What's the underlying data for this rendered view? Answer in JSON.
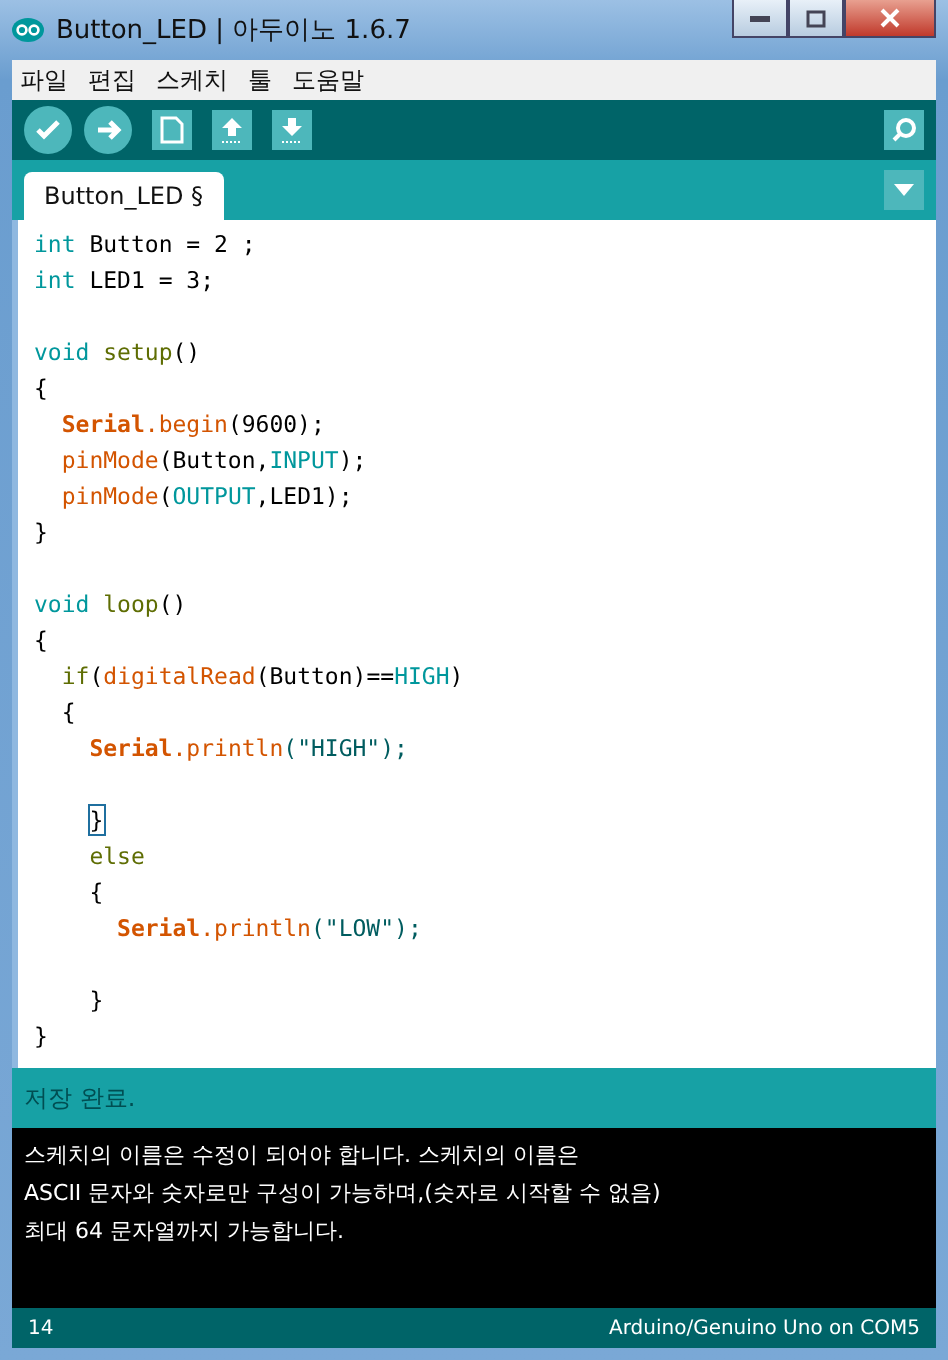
{
  "window": {
    "title": "Button_LED | 아두이노 1.6.7"
  },
  "menu": [
    "파일",
    "편집",
    "스케치",
    "툴",
    "도움말"
  ],
  "toolbar": [
    {
      "kind": "verify"
    },
    {
      "kind": "upload"
    },
    {
      "kind": "new"
    },
    {
      "kind": "open"
    },
    {
      "kind": "save"
    }
  ],
  "tabs": [
    {
      "label": "Button_LED §",
      "selected": true
    }
  ],
  "code": [
    [
      [
        {
          "kind": "type",
          "text": "int"
        },
        {
          "kind": "plain",
          "text": " Button = 2 ;"
        }
      ],
      [
        {
          "kind": "type",
          "text": "int"
        },
        {
          "kind": "plain",
          "text": " LED1 = 3;"
        }
      ]
    ],
    [
      [
        {
          "kind": "type",
          "text": "void "
        },
        {
          "kind": "fn",
          "text": "setup"
        },
        {
          "kind": "plain",
          "text": "()"
        }
      ],
      [
        {
          "kind": "plain",
          "text": "{"
        }
      ],
      [
        {
          "kind": "serial",
          "text": "  Serial"
        },
        {
          "kind": "call",
          "text": ".begin"
        },
        {
          "kind": "plain",
          "text": "(9600);"
        }
      ],
      [
        {
          "kind": "call",
          "text": "  pinMode"
        },
        {
          "kind": "plain",
          "text": "(Button,"
        },
        {
          "kind": "const",
          "text": "INPUT"
        },
        {
          "kind": "plain",
          "text": ");"
        }
      ],
      [
        {
          "kind": "call",
          "text": "  pinMode"
        },
        {
          "kind": "plain",
          "text": "("
        },
        {
          "kind": "const",
          "text": "OUTPUT"
        },
        {
          "kind": "plain",
          "text": ",LED1);"
        }
      ],
      [
        {
          "kind": "plain",
          "text": "}"
        }
      ]
    ],
    [
      [
        {
          "kind": "type",
          "text": "void "
        },
        {
          "kind": "fn",
          "text": "loop"
        },
        {
          "kind": "plain",
          "text": "()"
        }
      ],
      [
        {
          "kind": "plain",
          "text": "{"
        }
      ],
      [
        {
          "kind": "fn",
          "text": "  if"
        },
        {
          "kind": "plain",
          "text": "("
        },
        {
          "kind": "call",
          "text": "digitalRead"
        },
        {
          "kind": "plain",
          "text": "(Button)=="
        },
        {
          "kind": "const",
          "text": "HIGH"
        },
        {
          "kind": "plain",
          "text": ")"
        }
      ],
      [
        {
          "kind": "plain",
          "text": "  {"
        }
      ],
      [
        {
          "kind": "serial",
          "text": "    Serial"
        },
        {
          "kind": "call",
          "text": ".println"
        },
        {
          "kind": "string",
          "text": "(\"HIGH\");"
        }
      ]
    ],
    [
      [
        {
          "kind": "match",
          "text": "    }"
        }
      ],
      [
        {
          "kind": "fn",
          "text": "    else"
        }
      ],
      [
        {
          "kind": "plain",
          "text": "    {"
        }
      ],
      [
        {
          "kind": "serial",
          "text": "      Serial"
        },
        {
          "kind": "call",
          "text": ".println"
        },
        {
          "kind": "string",
          "text": "(\"LOW\");"
        }
      ]
    ],
    [
      [
        {
          "kind": "plain",
          "text": "    }"
        }
      ],
      [
        {
          "kind": "plain",
          "text": "}"
        }
      ]
    ]
  ],
  "status": "저장 완료.",
  "console": [
    "스케치의 이름은 수정이 되어야 합니다. 스케치의 이름은",
    "ASCII 문자와 숫자로만 구성이 가능하며,(숫자로 시작할 수 없음)",
    "최대 64 문자열까지 가능합니다."
  ],
  "footer": {
    "line": "14",
    "board": "Arduino/Genuino Uno on COM5"
  }
}
